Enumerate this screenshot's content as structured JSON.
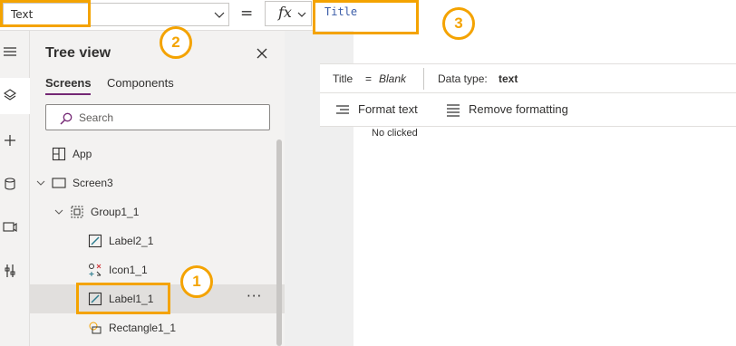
{
  "formula_bar": {
    "property_value": "Text",
    "equals": "=",
    "fx_label": "fx",
    "formula": "Title"
  },
  "formula_info": {
    "name": "Title",
    "equals": "=",
    "value": "Blank",
    "data_type_label": "Data type:",
    "data_type_value": "text"
  },
  "formula_tools": {
    "format_text": "Format text",
    "remove_formatting": "Remove formatting"
  },
  "tree_view": {
    "title": "Tree view",
    "tabs": [
      "Screens",
      "Components"
    ],
    "search_placeholder": "Search",
    "items": [
      {
        "label": "App",
        "icon": "app-icon"
      },
      {
        "label": "Screen3",
        "icon": "screen-icon"
      },
      {
        "label": "Group1_1",
        "icon": "group-icon"
      },
      {
        "label": "Label2_1",
        "icon": "label-icon"
      },
      {
        "label": "Icon1_1",
        "icon": "icon-control-icon"
      },
      {
        "label": "Label1_1",
        "icon": "label-icon",
        "selected": true
      },
      {
        "label": "Rectangle1_1",
        "icon": "rectangle-icon"
      }
    ],
    "more_label": "···"
  },
  "canvas": {
    "label_text": "No clicked"
  },
  "callouts": [
    "1",
    "2",
    "3"
  ],
  "colors": {
    "highlight": "#f4a300",
    "accent": "#742774",
    "formula_text": "#3b5da8",
    "selected_row": "#e1dfdd"
  }
}
